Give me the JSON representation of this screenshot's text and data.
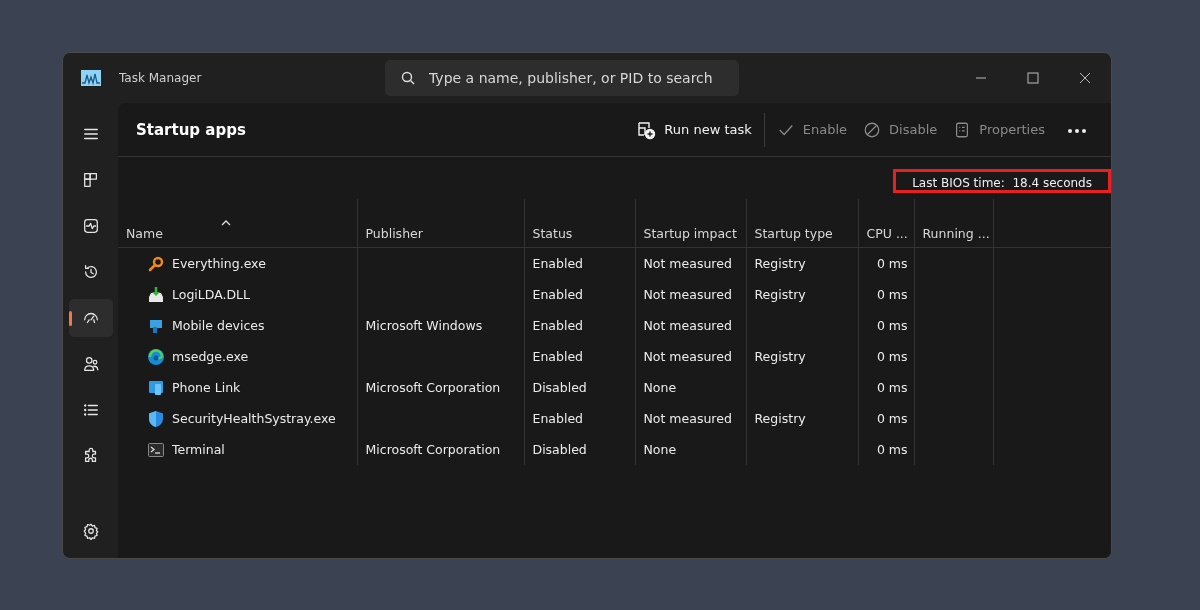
{
  "window": {
    "title": "Task Manager"
  },
  "search": {
    "placeholder": "Type a name, publisher, or PID to search"
  },
  "nav": [
    {
      "kind": "menu",
      "selected": false
    },
    {
      "kind": "processes",
      "selected": false
    },
    {
      "kind": "performance",
      "selected": false
    },
    {
      "kind": "history",
      "selected": false
    },
    {
      "kind": "startup",
      "selected": true
    },
    {
      "kind": "users",
      "selected": false
    },
    {
      "kind": "details",
      "selected": false
    },
    {
      "kind": "services",
      "selected": false
    }
  ],
  "nav_bottom": {
    "kind": "settings",
    "selected": false
  },
  "page": {
    "title": "Startup apps"
  },
  "toolbar": [
    {
      "kind": "run",
      "label": "Run new task",
      "disabled": false
    },
    {
      "kind": "enable",
      "label": "Enable",
      "disabled": true
    },
    {
      "kind": "disable",
      "label": "Disable",
      "disabled": true
    },
    {
      "kind": "properties",
      "label": "Properties",
      "disabled": true
    }
  ],
  "bios": {
    "label": "Last BIOS time:",
    "value": "18.4 seconds",
    "highlighted": true
  },
  "table": {
    "columns": [
      {
        "label": "Name",
        "sorted": true
      },
      {
        "label": "Publisher",
        "sorted": false
      },
      {
        "label": "Status",
        "sorted": false
      },
      {
        "label": "Startup impact",
        "sorted": false
      },
      {
        "label": "Startup type",
        "sorted": false
      },
      {
        "label": "CPU ...",
        "sorted": false
      },
      {
        "label": "Running ...",
        "sorted": false
      }
    ],
    "rows": [
      {
        "kind": "search",
        "cells": [
          "Everything.exe",
          "",
          "Enabled",
          "Not measured",
          "Registry",
          "0 ms",
          ""
        ]
      },
      {
        "kind": "download",
        "cells": [
          "LogiLDA.DLL",
          "",
          "Enabled",
          "Not measured",
          "Registry",
          "0 ms",
          ""
        ]
      },
      {
        "kind": "device",
        "cells": [
          "Mobile devices",
          "Microsoft Windows",
          "Enabled",
          "Not measured",
          "",
          "0 ms",
          ""
        ]
      },
      {
        "kind": "browser",
        "cells": [
          "msedge.exe",
          "",
          "Enabled",
          "Not measured",
          "Registry",
          "0 ms",
          ""
        ]
      },
      {
        "kind": "phone",
        "cells": [
          "Phone Link",
          "Microsoft Corporation",
          "Disabled",
          "None",
          "",
          "0 ms",
          ""
        ]
      },
      {
        "kind": "shield",
        "cells": [
          "SecurityHealthSystray.exe",
          "",
          "Enabled",
          "Not measured",
          "Registry",
          "0 ms",
          ""
        ]
      },
      {
        "kind": "terminal",
        "cells": [
          "Terminal",
          "Microsoft Corporation",
          "Disabled",
          "None",
          "",
          "0 ms",
          ""
        ]
      }
    ]
  }
}
